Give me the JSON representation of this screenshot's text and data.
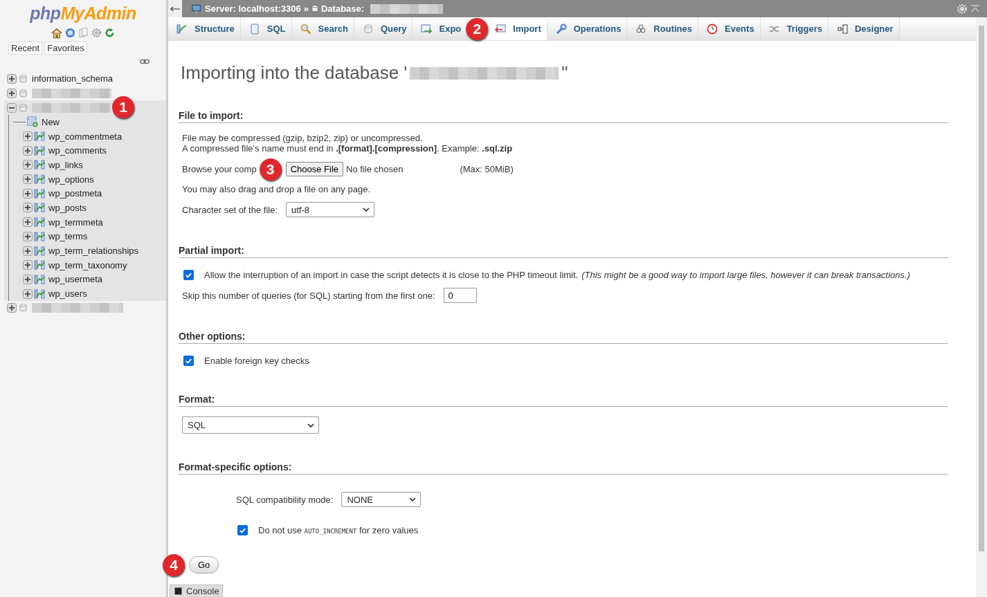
{
  "logo": {
    "part_1": "php",
    "part_2": "MyAdmin"
  },
  "sidebar": {
    "buttons": [
      "Recent",
      "Favorites"
    ],
    "databases": [
      {
        "name": "information_schema",
        "redacted": false,
        "expanded": false
      },
      {
        "redacted": true,
        "expanded": false
      },
      {
        "redacted": true,
        "expanded": true,
        "children": [
          {
            "kind": "new",
            "name": "New"
          },
          {
            "kind": "table",
            "name": "wp_commentmeta"
          },
          {
            "kind": "table",
            "name": "wp_comments"
          },
          {
            "kind": "table",
            "name": "wp_links"
          },
          {
            "kind": "table",
            "name": "wp_options"
          },
          {
            "kind": "table",
            "name": "wp_postmeta"
          },
          {
            "kind": "table",
            "name": "wp_posts"
          },
          {
            "kind": "table",
            "name": "wp_termmeta"
          },
          {
            "kind": "table",
            "name": "wp_terms"
          },
          {
            "kind": "table",
            "name": "wp_term_relationships"
          },
          {
            "kind": "table",
            "name": "wp_term_taxonomy"
          },
          {
            "kind": "table",
            "name": "wp_usermeta"
          },
          {
            "kind": "table",
            "name": "wp_users"
          }
        ]
      },
      {
        "redacted": true,
        "expanded": false
      }
    ]
  },
  "breadcrumb": {
    "server": "Server: localhost:3306",
    "separator": "»",
    "database": "Database:"
  },
  "tabs": [
    {
      "label": "Structure",
      "selected": false
    },
    {
      "label": "SQL",
      "selected": false
    },
    {
      "label": "Search",
      "selected": false
    },
    {
      "label": "Query",
      "selected": false
    },
    {
      "label": "Expo",
      "selected": false
    },
    {
      "label": "Import",
      "selected": true
    },
    {
      "label": "Operations",
      "selected": false
    },
    {
      "label": "Routines",
      "selected": false
    },
    {
      "label": "Events",
      "selected": false
    },
    {
      "label": "Triggers",
      "selected": false
    },
    {
      "label": "Designer",
      "selected": false
    }
  ],
  "heading": {
    "before": "Importing into the database '",
    "after": "\""
  },
  "file_to_import": {
    "title": "File to import:",
    "note_1": "File may be compressed (gzip, bzip2, zip) or uncompressed.",
    "note_2": "A compressed file's name must end in **.[format].[compression]**. Example: **.sql.zip**",
    "browse_label": "Browse your comp",
    "choose_button": "Choose File",
    "file_status": "No file chosen",
    "max_size": "(Max: 50MiB)",
    "drag_note": "You may also drag and drop a file on any page.",
    "charset_label": "Character set of the file:",
    "charset_value": "utf-8"
  },
  "partial_import": {
    "title": "Partial import:",
    "allow_interrupt": {
      "checked": true,
      "label": "Allow the interruption of an import in case the script detects it is close to the PHP timeout limit.",
      "hint": "(This might be a good way to import large files, however it can break transactions.)"
    },
    "skip_label": "Skip this number of queries (for SQL) starting from the first one:",
    "skip_value": "0"
  },
  "other_options": {
    "title": "Other options:",
    "foreign_keys": {
      "checked": true,
      "label": "Enable foreign key checks"
    }
  },
  "format": {
    "title": "Format:",
    "value": "SQL"
  },
  "format_specific": {
    "title": "Format-specific options:",
    "compat_label": "SQL compatibility mode:",
    "compat_value": "NONE",
    "auto_increment": {
      "checked": true,
      "before": "Do not use",
      "code": "AUTO_INCREMENT",
      "after": "for zero values"
    }
  },
  "go_button": "Go",
  "console": "Console",
  "callouts": [
    "1",
    "2",
    "3",
    "4"
  ]
}
